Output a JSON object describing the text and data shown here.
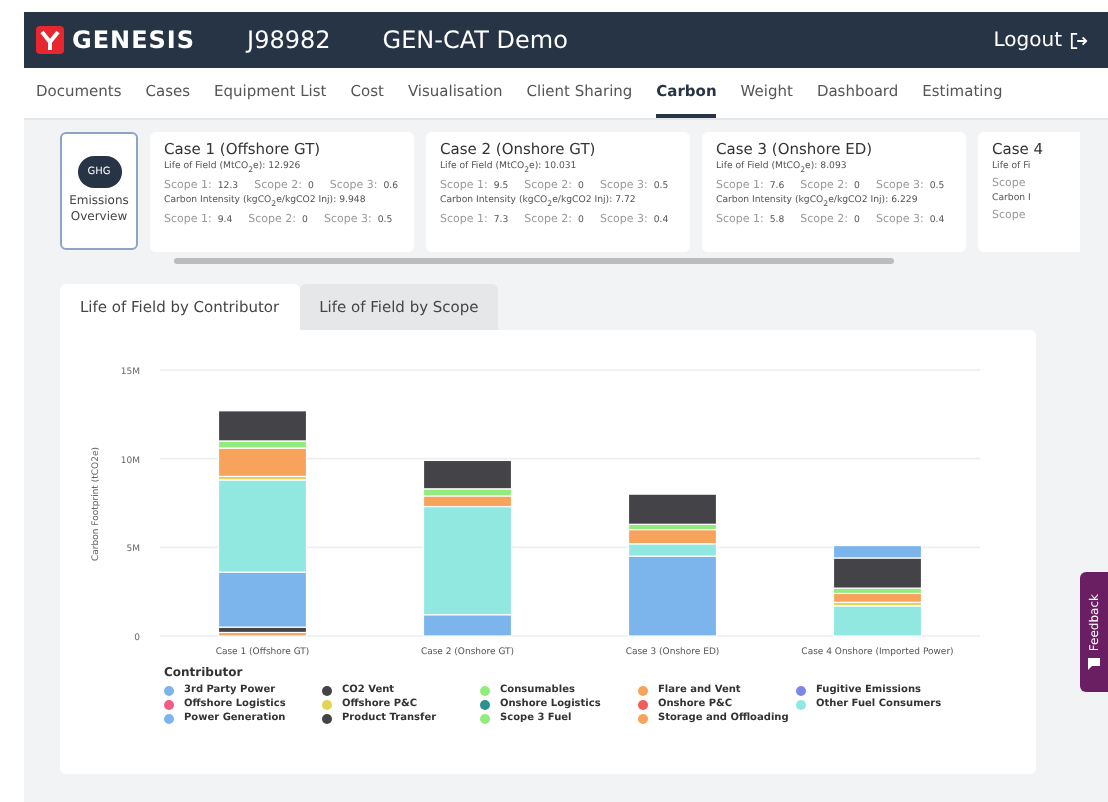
{
  "header": {
    "brand": "GENESIS",
    "job": "J98982",
    "project": "GEN-CAT Demo",
    "logout": "Logout"
  },
  "nav": [
    {
      "label": "Documents",
      "selected": false
    },
    {
      "label": "Cases",
      "selected": false
    },
    {
      "label": "Equipment List",
      "selected": false
    },
    {
      "label": "Cost",
      "selected": false
    },
    {
      "label": "Visualisation",
      "selected": false
    },
    {
      "label": "Client Sharing",
      "selected": false
    },
    {
      "label": "Carbon",
      "selected": true
    },
    {
      "label": "Weight",
      "selected": false
    },
    {
      "label": "Dashboard",
      "selected": false
    },
    {
      "label": "Estimating",
      "selected": false
    }
  ],
  "overview": {
    "icon_text": "GHG",
    "label": "Emissions Overview"
  },
  "cases": [
    {
      "title": "Case 1 (Offshore GT)",
      "lof_label": "Life of Field (MtCO$_{2}$e): 12.926",
      "scopes": [
        {
          "label": "Scope 1:",
          "value": "12.3"
        },
        {
          "label": "Scope 2:",
          "value": "0"
        },
        {
          "label": "Scope 3:",
          "value": "0.6"
        }
      ],
      "ci_label": "Carbon Intensity (kgCO$_{2}$e/kgCO2 Inj): 9.948",
      "ci_scopes": [
        {
          "label": "Scope 1:",
          "value": "9.4"
        },
        {
          "label": "Scope 2:",
          "value": "0"
        },
        {
          "label": "Scope 3:",
          "value": "0.5"
        }
      ]
    },
    {
      "title": "Case 2 (Onshore GT)",
      "lof_label": "Life of Field (MtCO$_{2}$e): 10.031",
      "scopes": [
        {
          "label": "Scope 1:",
          "value": "9.5"
        },
        {
          "label": "Scope 2:",
          "value": "0"
        },
        {
          "label": "Scope 3:",
          "value": "0.5"
        }
      ],
      "ci_label": "Carbon Intensity (kgCO$_{2}$e/kgCO2 Inj): 7.72",
      "ci_scopes": [
        {
          "label": "Scope 1:",
          "value": "7.3"
        },
        {
          "label": "Scope 2:",
          "value": "0"
        },
        {
          "label": "Scope 3:",
          "value": "0.4"
        }
      ]
    },
    {
      "title": "Case 3 (Onshore ED)",
      "lof_label": "Life of Field (MtCO$_{2}$e): 8.093",
      "scopes": [
        {
          "label": "Scope 1:",
          "value": "7.6"
        },
        {
          "label": "Scope 2:",
          "value": "0"
        },
        {
          "label": "Scope 3:",
          "value": "0.5"
        }
      ],
      "ci_label": "Carbon Intensity (kgCO$_{2}$e/kgCO2 Inj): 6.229",
      "ci_scopes": [
        {
          "label": "Scope 1:",
          "value": "5.8"
        },
        {
          "label": "Scope 2:",
          "value": "0"
        },
        {
          "label": "Scope 3:",
          "value": "0.4"
        }
      ]
    },
    {
      "title": "Case 4",
      "lof_label": "Life of Fi",
      "scopes": [
        {
          "label": "Scope"
        }
      ],
      "ci_label": "Carbon I",
      "ci_scopes": [
        {
          "label": "Scope"
        }
      ]
    }
  ],
  "tabs": [
    {
      "label": "Life of Field by Contributor",
      "selected": true
    },
    {
      "label": "Life of Field by Scope",
      "selected": false
    }
  ],
  "chart": {
    "chart_data": {
      "type": "bar",
      "stacked": true,
      "orientation": "vertical",
      "ylabel": "Carbon Footprint (tCO2e)",
      "categories": [
        "Case 1 (Offshore GT)",
        "Case 2 (Onshore GT)",
        "Case 3 (Onshore ED)",
        "Case 4 Onshore (Imported Power)"
      ],
      "ylim": [
        0,
        15000000
      ],
      "yticks": [
        {
          "value": 0,
          "label": "0"
        },
        {
          "value": 5000000,
          "label": "5M"
        },
        {
          "value": 10000000,
          "label": "10M"
        },
        {
          "value": 15000000,
          "label": "15M"
        }
      ],
      "series": [
        {
          "name": "Storage and Offloading",
          "color": "#f7a35c",
          "values": [
            200000,
            0,
            0,
            null
          ]
        },
        {
          "name": "Product Transfer",
          "color": "#434348",
          "values": [
            300000,
            0,
            0,
            0
          ]
        },
        {
          "name": "Power Generation",
          "color": "#7cb5ec",
          "values": [
            3100000,
            1200000,
            4500000,
            0
          ]
        },
        {
          "name": "Other Fuel Consumers",
          "color": "#91e8e1",
          "values": [
            5200000,
            6100000,
            700000,
            1700000
          ]
        },
        {
          "name": "Offshore P&C",
          "color": "#e4d354",
          "values": [
            200000,
            null,
            null,
            200000
          ]
        },
        {
          "name": "Flare and Vent",
          "color": "#f7a35c",
          "values": [
            1600000,
            600000,
            800000,
            500000
          ]
        },
        {
          "name": "Consumables",
          "color": "#90ed7d",
          "values": [
            400000,
            400000,
            300000,
            300000
          ]
        },
        {
          "name": "CO2 Vent",
          "color": "#434348",
          "values": [
            1700000,
            1600000,
            1700000,
            1700000
          ]
        },
        {
          "name": "3rd Party Power",
          "color": "#7cb5ec",
          "values": [
            0,
            0,
            0,
            700000
          ]
        },
        {
          "name": "Fugitive Emissions",
          "color": "#8085e9",
          "values": [
            0,
            0,
            0,
            0
          ]
        },
        {
          "name": "Offshore Logistics",
          "color": "#f15c80",
          "values": [
            0,
            0,
            0,
            0
          ]
        },
        {
          "name": "Onshore Logistics",
          "color": "#2b908f",
          "values": [
            0,
            0,
            0,
            0
          ]
        },
        {
          "name": "Onshore P&C",
          "color": "#f45b5b",
          "values": [
            0,
            0,
            0,
            0
          ]
        },
        {
          "name": "Scope 3 Fuel",
          "color": "#90ed7d",
          "values": [
            0,
            0,
            0,
            0
          ]
        }
      ],
      "legend_title": "Contributor"
    }
  },
  "feedback": "Feedback"
}
